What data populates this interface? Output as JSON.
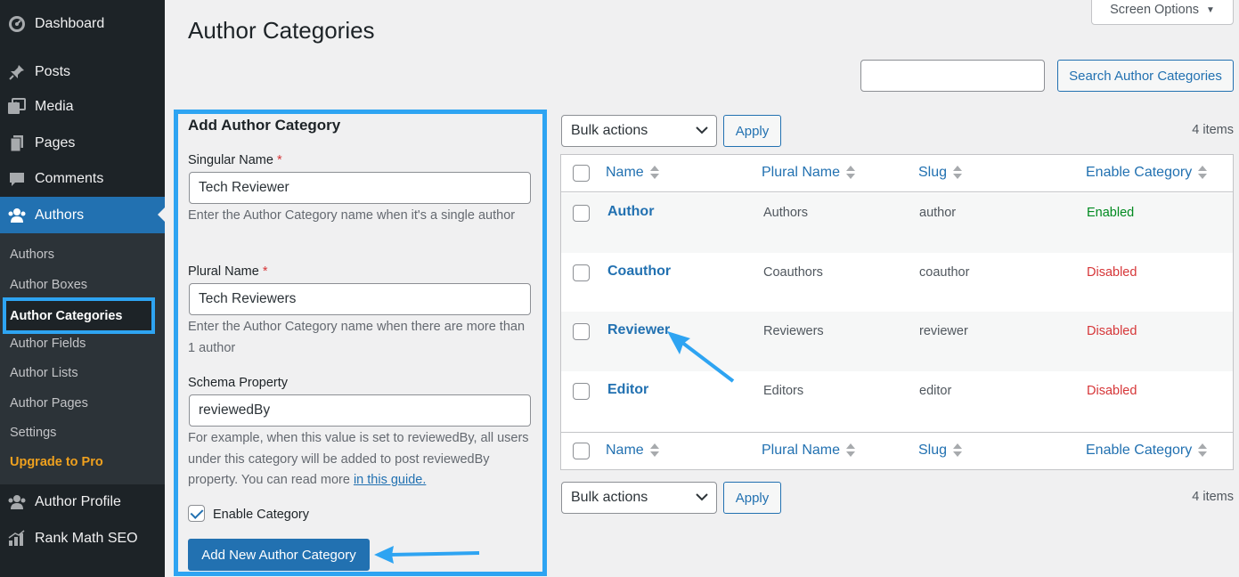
{
  "sidebar": {
    "menu": [
      {
        "label": "Dashboard",
        "icon": "dashboard-icon"
      },
      {
        "label": "Posts",
        "icon": "pin-icon"
      },
      {
        "label": "Media",
        "icon": "media-icon"
      },
      {
        "label": "Pages",
        "icon": "pages-icon"
      },
      {
        "label": "Comments",
        "icon": "comments-icon"
      },
      {
        "label": "Authors",
        "icon": "users-icon",
        "current": true
      }
    ],
    "submenu": [
      {
        "label": "Authors"
      },
      {
        "label": "Author Boxes"
      },
      {
        "label": "Author Categories",
        "active": true
      },
      {
        "label": "Author Fields"
      },
      {
        "label": "Author Lists"
      },
      {
        "label": "Author Pages"
      },
      {
        "label": "Settings"
      },
      {
        "label": "Upgrade to Pro",
        "highlight": true
      }
    ],
    "bottom_menu": [
      {
        "label": "Author Profile",
        "icon": "users-icon"
      },
      {
        "label": "Rank Math SEO",
        "icon": "rank-math-icon"
      }
    ]
  },
  "header": {
    "title": "Author Categories",
    "screen_options": "Screen Options"
  },
  "search": {
    "value": "",
    "button": "Search Author Categories"
  },
  "form": {
    "title": "Add Author Category",
    "singular": {
      "label": "Singular Name",
      "required_mark": "*",
      "value": "Tech Reviewer",
      "description": "Enter the Author Category name when it's a single author"
    },
    "plural": {
      "label": "Plural Name",
      "required_mark": "*",
      "value": "Tech Reviewers",
      "description": "Enter the Author Category name when there are more than 1 author"
    },
    "schema": {
      "label": "Schema Property",
      "value": "reviewedBy",
      "description": "For example, when this value is set to reviewedBy, all users under this category will be added to post reviewedBy property. You can read more",
      "link": "in this guide."
    },
    "enable": {
      "label": "Enable Category",
      "checked": true
    },
    "submit": "Add New Author Category"
  },
  "table": {
    "bulk_top": "Bulk actions",
    "apply_top": "Apply",
    "bulk_bottom": "Bulk actions",
    "apply_bottom": "Apply",
    "count_top": "4 items",
    "count_bottom": "4 items",
    "columns": [
      "Name",
      "Plural Name",
      "Slug",
      "Enable Category"
    ],
    "rows": [
      {
        "name": "Author",
        "plural": "Authors",
        "slug": "author",
        "status": "Enabled"
      },
      {
        "name": "Coauthor",
        "plural": "Coauthors",
        "slug": "coauthor",
        "status": "Disabled"
      },
      {
        "name": "Reviewer",
        "plural": "Reviewers",
        "slug": "reviewer",
        "status": "Disabled"
      },
      {
        "name": "Editor",
        "plural": "Editors",
        "slug": "editor",
        "status": "Disabled"
      }
    ]
  },
  "colors": {
    "accent": "#2271b1",
    "highlight": "#2ea4f2",
    "enabled": "#008a20",
    "disabled": "#d63638",
    "sidebar": "#1d2327"
  }
}
